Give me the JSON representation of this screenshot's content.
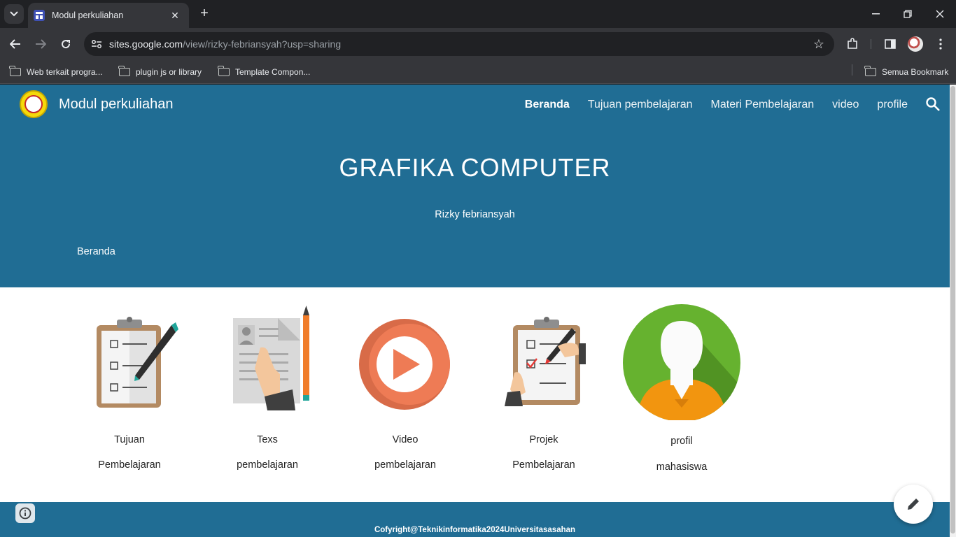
{
  "browser": {
    "tab_title": "Modul perkuliahan",
    "url_host": "sites.google.com",
    "url_path": "/view/rizky-febriansyah?usp=sharing",
    "bookmarks": [
      "Web terkait progra...",
      "plugin js or library",
      "Template Compon..."
    ],
    "all_bookmarks": "Semua Bookmark"
  },
  "site": {
    "title": "Modul perkuliahan",
    "nav": [
      "Beranda",
      "Tujuan pembelajaran",
      "Materi Pembelajaran",
      "video",
      "profile"
    ],
    "active_nav": "Beranda"
  },
  "hero": {
    "title": "GRAFIKA COMPUTER",
    "subtitle": "Rizky febriansyah",
    "breadcrumb": "Beranda"
  },
  "cards": [
    {
      "line1": "Tujuan",
      "line2": "Pembelajaran",
      "icon": "clipboard-checklist-icon"
    },
    {
      "line1": "Texs",
      "line2": "pembelajaran",
      "icon": "document-pencil-icon"
    },
    {
      "line1": "Video",
      "line2": "pembelajaran",
      "icon": "play-button-icon"
    },
    {
      "line1": "Projek",
      "line2": "Pembelajaran",
      "icon": "clipboard-marking-icon"
    },
    {
      "line1": "profil",
      "line2": "mahasiswa",
      "icon": "user-avatar-icon"
    }
  ],
  "footer": {
    "text": "Cofyright@Teknikinformatika2024Universitasasahan"
  },
  "colors": {
    "hero_bg": "#206d94",
    "play_orange": "#e8734f",
    "avatar_green": "#66b22f"
  }
}
